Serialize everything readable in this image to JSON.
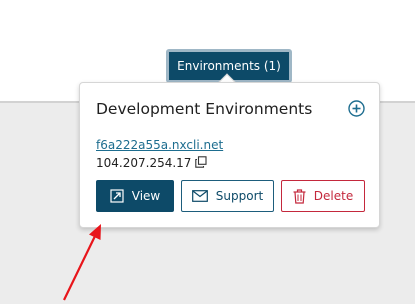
{
  "header": {
    "environments_button_label": "Environments (1)"
  },
  "popover": {
    "title": "Development Environments",
    "add_icon": "plus-circle-icon",
    "environment": {
      "host": "f6a222a55a.nxcli.net",
      "ip": "104.207.254.17",
      "copy_icon": "copy-icon"
    },
    "actions": {
      "view_label": "View",
      "view_icon": "external-link-icon",
      "support_label": "Support",
      "support_icon": "envelope-icon",
      "delete_label": "Delete",
      "delete_icon": "trash-icon"
    }
  },
  "colors": {
    "primary": "#0d4a68",
    "link": "#1d6d8f",
    "danger": "#c4283c",
    "annotation": "#e8151b"
  }
}
